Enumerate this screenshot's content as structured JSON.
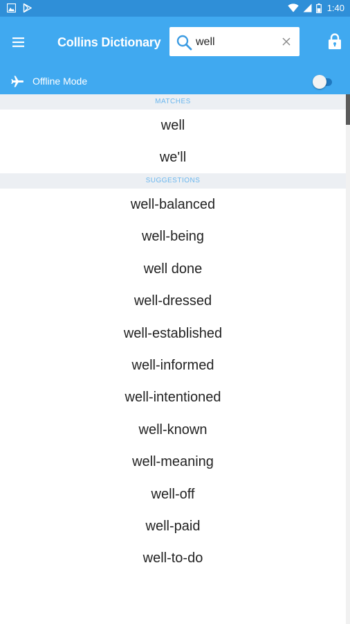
{
  "status_bar": {
    "time": "1:40",
    "left_icons": [
      "image-icon",
      "play-store-icon"
    ],
    "right_icons": [
      "wifi-icon",
      "signal-icon",
      "battery-icon"
    ]
  },
  "app_bar": {
    "title": "Collins Dictionary",
    "menu_icon": "hamburger-menu-icon",
    "lock_icon": "lock-icon"
  },
  "search": {
    "value": "well",
    "placeholder": "",
    "search_icon": "search-icon",
    "clear_icon": "close-icon"
  },
  "offline": {
    "label": "Offline Mode",
    "icon": "airplane-icon",
    "enabled": false
  },
  "matches": {
    "header": "MATCHES",
    "items": [
      "well",
      "we'll"
    ]
  },
  "suggestions": {
    "header": "SUGGESTIONS",
    "items": [
      "well-balanced",
      "well-being",
      "well done",
      "well-dressed",
      "well-established",
      "well-informed",
      "well-intentioned",
      "well-known",
      "well-meaning",
      "well-off",
      "well-paid",
      "well-to-do"
    ]
  },
  "colors": {
    "app_bar": "#40a9f0",
    "status_bar": "#2f8fd8",
    "section_header_bg": "#eceff3",
    "section_header_text": "#6ab6ee"
  }
}
